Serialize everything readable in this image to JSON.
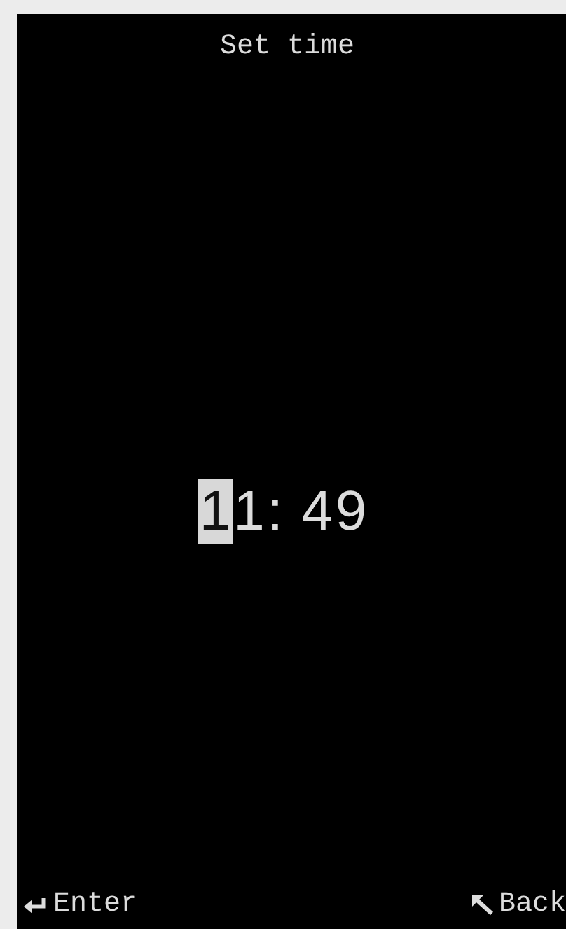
{
  "title": "Set time",
  "time_digits": [
    {
      "text": "1",
      "selected": true
    },
    {
      "text": "1",
      "selected": false
    },
    {
      "text": ": ",
      "selected": false
    },
    {
      "text": "4",
      "selected": false
    },
    {
      "text": "9",
      "selected": false
    }
  ],
  "softkeys": [
    {
      "kind": "enter",
      "label": "Enter"
    },
    {
      "kind": "back",
      "label": "Back"
    }
  ]
}
